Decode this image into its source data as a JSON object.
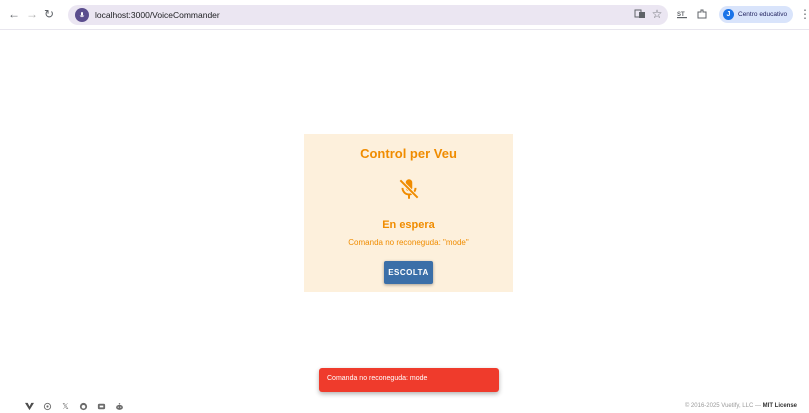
{
  "browser": {
    "url": "localhost:3000/VoiceCommander",
    "profile_initial": "J",
    "profile_label": "Centro educativo"
  },
  "card": {
    "title": "Control per Veu",
    "icon": "mic-off-icon",
    "status": "En espera",
    "message": "Comanda no reconeguda: \"mode\"",
    "button_label": "ESCOLTA"
  },
  "snackbar": {
    "text": "Comanda no reconeguda: mode"
  },
  "footer": {
    "copyright": "© 2016-2025 Vuetify, LLC —",
    "license": "MIT License",
    "icons": [
      "vuetify-logo-icon",
      "settings-icon",
      "x-icon",
      "github-icon",
      "discord-icon",
      "reddit-icon"
    ]
  },
  "colors": {
    "accent": "#f08c00",
    "card_bg": "#fdf0dc",
    "button": "#3b6fa8",
    "snackbar": "#ef3b2c"
  }
}
